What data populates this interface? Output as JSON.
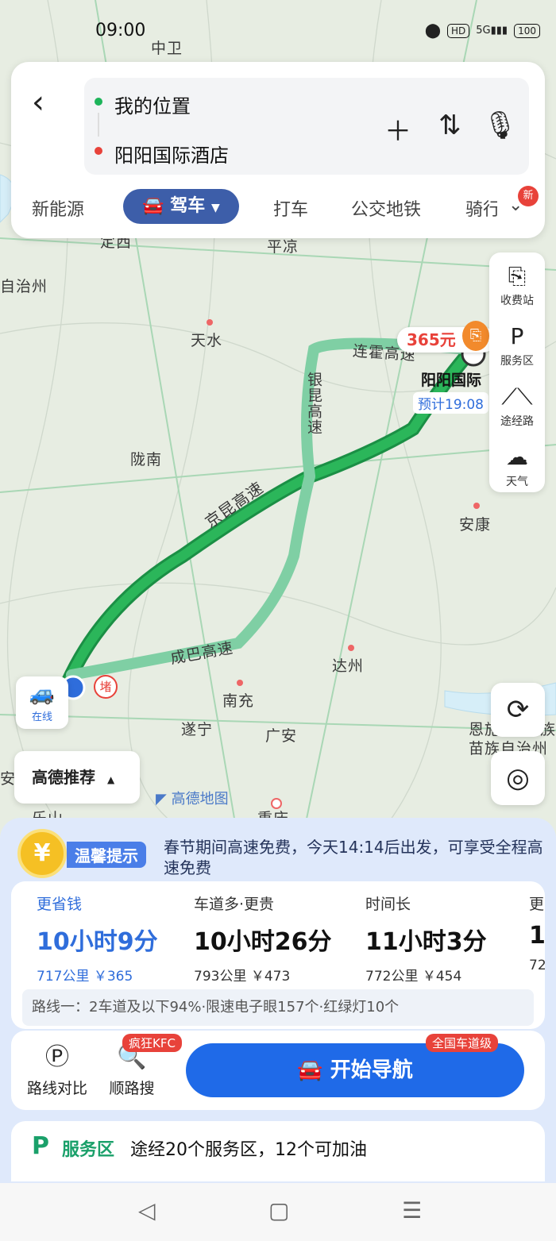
{
  "status": {
    "time": "09:00",
    "indicators": [
      "HD",
      "5G",
      "100"
    ]
  },
  "header": {
    "back_icon": "chevron-left-icon",
    "origin": "我的位置",
    "destination": "阳阳国际酒店",
    "add_icon": "plus-icon",
    "swap_icon": "swap-icon",
    "voice_icon": "mic-icon"
  },
  "modes": [
    {
      "label": "新能源"
    },
    {
      "label": "驾车",
      "active": true
    },
    {
      "label": "打车"
    },
    {
      "label": "公交地铁"
    },
    {
      "label": "骑行"
    }
  ],
  "new_badge": "新",
  "sidebar": [
    {
      "label": "收费站",
      "icon": "toll-icon"
    },
    {
      "label": "服务区",
      "icon": "service-area-icon"
    },
    {
      "label": "途经路",
      "icon": "road-icon"
    },
    {
      "label": "天气",
      "icon": "cloud-icon"
    }
  ],
  "map": {
    "cities": [
      "中卫",
      "定西",
      "平凉",
      "自治州",
      "天水",
      "陇南",
      "安康",
      "达州",
      "南充",
      "遂宁",
      "广安",
      "重庆",
      "乐山",
      "安",
      "恩施",
      "族",
      "苗族自治州"
    ],
    "roads": [
      "连霍高速",
      "银昆高速",
      "京昆高速",
      "成巴高速"
    ],
    "toll": "365元",
    "destination_label": "阳阳国际",
    "eta": "预计19:08",
    "start_marker": "堵",
    "online_label": "在线",
    "recommend_label": "高德推荐",
    "logo": "高德地图"
  },
  "tip": {
    "coin": "¥",
    "label": "温馨提示",
    "text": "春节期间高速免费，今天14:14后出发，可享受全程高速免费"
  },
  "routes": [
    {
      "tag": "更省钱",
      "duration": "10小时9分",
      "info": "717公里 ￥365",
      "selected": true
    },
    {
      "tag": "车道多·更贵",
      "duration": "10小时26分",
      "info": "793公里 ￥473"
    },
    {
      "tag": "时间长",
      "duration": "11小时3分",
      "info": "772公里 ￥454"
    },
    {
      "tag": "更",
      "duration": "1",
      "info": "72"
    }
  ],
  "summary": "路线一：2车道及以下94%·限速电子眼157个·红绿灯10个",
  "actions": {
    "compare": "路线对比",
    "search": "顺路搜",
    "search_tag": "疯狂KFC",
    "navigate": "开始导航",
    "navigate_tag": "全国车道级"
  },
  "service": {
    "icon": "P",
    "title": "服务区",
    "text": "途经20个服务区，12个可加油"
  }
}
